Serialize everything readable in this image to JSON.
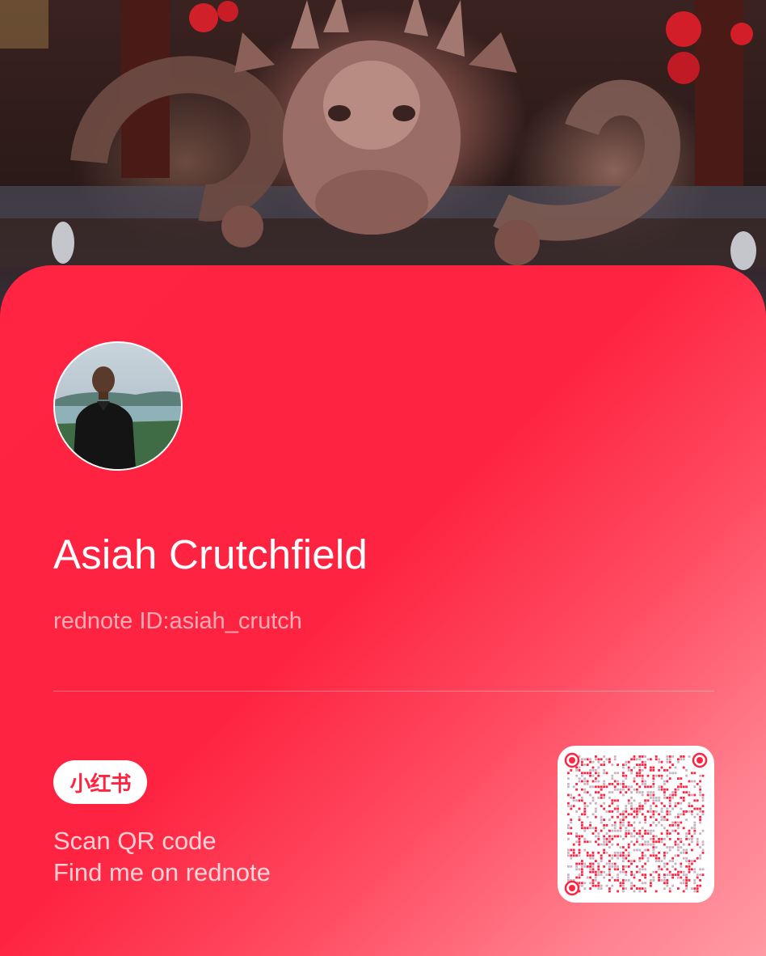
{
  "profile": {
    "name": "Asiah Crutchfield",
    "id_text": "rednote ID:asiah_crutch"
  },
  "brand": {
    "logo_text": "小红书",
    "accent_color": "#ff2442"
  },
  "share": {
    "line1": "Scan QR code",
    "line2": "Find me on rednote"
  },
  "icons": {
    "avatar": "profile-photo",
    "qr": "qr-code",
    "background": "dragon-statue-photo"
  }
}
